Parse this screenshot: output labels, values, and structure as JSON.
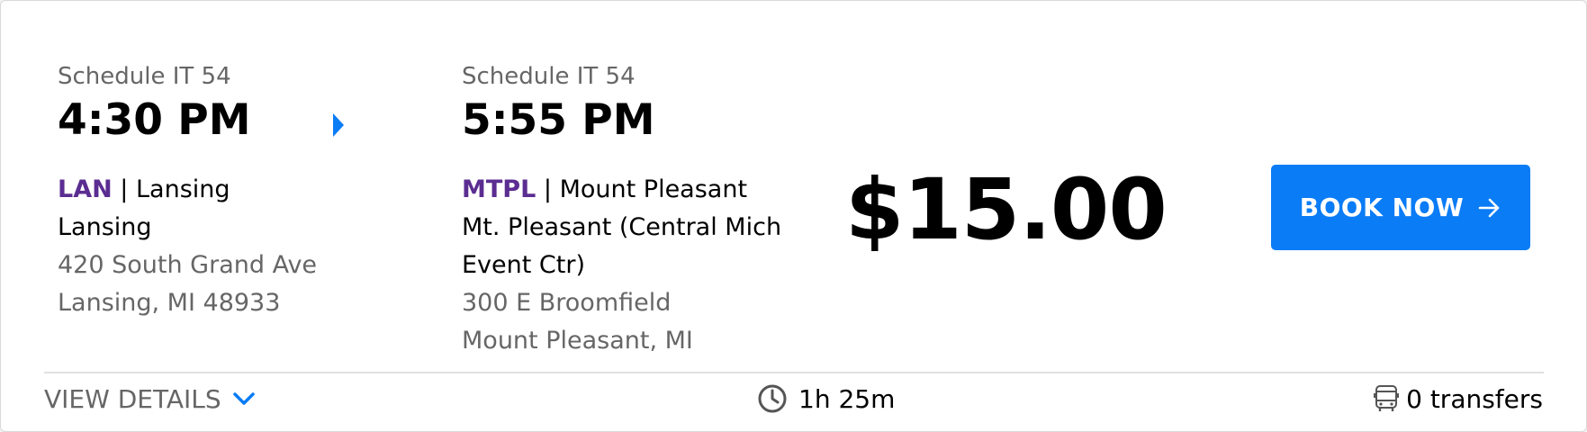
{
  "departure": {
    "schedule": "Schedule IT 54",
    "time": "4:30 PM",
    "code": "LAN",
    "station_name": "Lansing",
    "location": "Lansing",
    "address_line1": "420 South Grand Ave",
    "address_line2": "Lansing, MI 48933"
  },
  "arrival": {
    "schedule": "Schedule IT 54",
    "time": "5:55 PM",
    "code": "MTPL",
    "station_name": "Mount Pleasant",
    "location_line1": "Mt. Pleasant (Central Mich",
    "location_line2": "Event Ctr)",
    "address_line1": "300 E Broomfield",
    "address_line2": "Mount Pleasant, MI"
  },
  "separator": "|",
  "price": "$15.00",
  "book_button": {
    "label": "BOOK NOW",
    "icon": "arrow-right-icon"
  },
  "footer": {
    "view_details_label": "VIEW DETAILS",
    "duration": "1h 25m",
    "transfers": "0 transfers"
  },
  "colors": {
    "accent": "#0a7cf6",
    "station_code": "#5b2d91",
    "muted_text": "#666666"
  }
}
